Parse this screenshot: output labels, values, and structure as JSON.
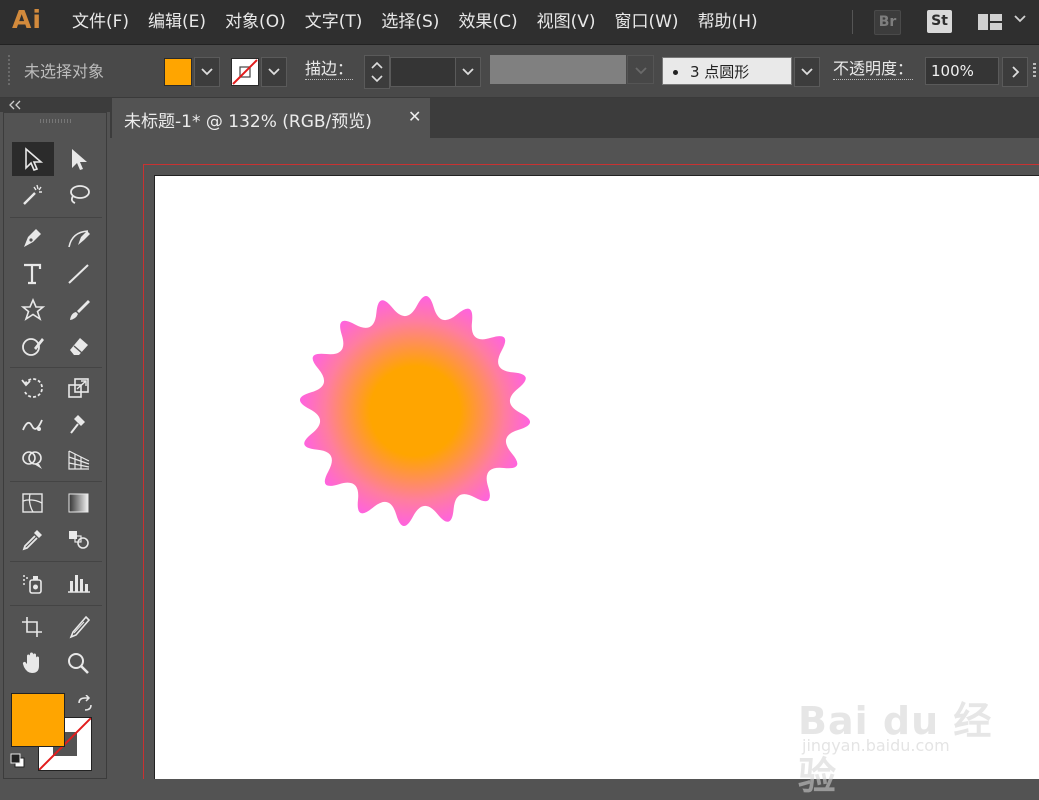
{
  "app": {
    "logo": "Ai"
  },
  "menu": [
    "文件(F)",
    "编辑(E)",
    "对象(O)",
    "文字(T)",
    "选择(S)",
    "效果(C)",
    "视图(V)",
    "窗口(W)",
    "帮助(H)"
  ],
  "app_switcher": {
    "bridge": "Br",
    "stock": "St"
  },
  "control_bar": {
    "selection_status": "未选择对象",
    "fill_color": "#ffa500",
    "stroke_label": "描边：",
    "brush_value": "3 点圆形",
    "opacity_label": "不透明度：",
    "opacity_value": "100%"
  },
  "document_tab": {
    "title": "未标题-1* @ 132% (RGB/预览)",
    "close": "✕"
  },
  "artwork": {
    "shape": "starburst",
    "center_color": "#ffa500",
    "edge_color": "#ff55ff"
  },
  "watermark": {
    "logo": "Bai du 经验",
    "url": "jingyan.baidu.com"
  },
  "icons": {
    "tools": [
      "selection-tool",
      "direct-selection-tool",
      "magic-wand-tool",
      "lasso-tool",
      "pen-tool",
      "curvature-tool",
      "type-tool",
      "line-tool",
      "star-tool",
      "paintbrush-tool",
      "shaper-tool",
      "eraser-tool",
      "rotate-tool",
      "scale-tool",
      "warp-tool",
      "puppet-warp-tool",
      "shape-builder-tool",
      "perspective-grid-tool",
      "mesh-tool",
      "gradient-tool",
      "eyedropper-tool",
      "blend-tool",
      "symbol-sprayer-tool",
      "column-graph-tool",
      "artboard-tool",
      "slice-tool",
      "hand-tool",
      "zoom-tool"
    ]
  }
}
